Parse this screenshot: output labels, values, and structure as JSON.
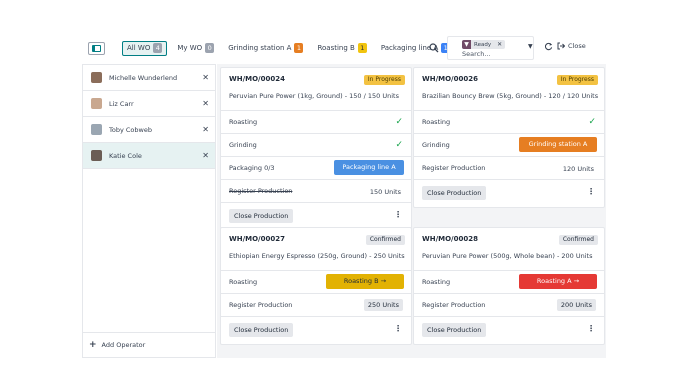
{
  "topbar": {
    "tabs": [
      {
        "label": "All WO",
        "count": "4",
        "badge_color": "grey",
        "active": true
      },
      {
        "label": "My WO",
        "count": "0",
        "badge_color": "grey",
        "active": false
      },
      {
        "label": "Grinding station A",
        "count": "1",
        "badge_color": "orange",
        "active": false
      },
      {
        "label": "Roasting B",
        "count": "1",
        "badge_color": "yellow",
        "active": false
      },
      {
        "label": "Packaging line A",
        "count": "1",
        "badge_color": "blue",
        "active": false
      }
    ],
    "add_tab": "+",
    "search": {
      "facet": "Ready",
      "placeholder": "Search..."
    },
    "close_label": "Close"
  },
  "operators": [
    {
      "name": "Michelle Wunderlend",
      "avatar_color": "#8b6d5a",
      "selected": false
    },
    {
      "name": "Liz Carr",
      "avatar_color": "#c9a890",
      "selected": false
    },
    {
      "name": "Toby Cobweb",
      "avatar_color": "#9aa6b2",
      "selected": false
    },
    {
      "name": "Katie Cole",
      "avatar_color": "#6b5d55",
      "selected": true
    }
  ],
  "add_operator_label": "Add Operator",
  "cards": [
    {
      "id": "WH/MO/00024",
      "status": "In Progress",
      "product": "Peruvian Pure Power (1kg, Ground) - 150 / 150 Units",
      "rows": [
        {
          "label": "Roasting",
          "type": "done"
        },
        {
          "label": "Grinding",
          "type": "done"
        },
        {
          "label": "Packaging",
          "extra": "0/3",
          "type": "button",
          "button": "Packaging line A",
          "color": "blue"
        },
        {
          "label": "Register Production",
          "type": "qty",
          "qty": "150 Units",
          "strike": true
        }
      ],
      "footer": "Close Production"
    },
    {
      "id": "WH/MO/00026",
      "status": "In Progress",
      "product": "Brazilian Bouncy Brew (5kg, Ground) - 120 / 120 Units",
      "rows": [
        {
          "label": "Roasting",
          "type": "done"
        },
        {
          "label": "Grinding",
          "type": "button",
          "button": "Grinding station A",
          "color": "orange"
        },
        {
          "label": "Register Production",
          "type": "qty",
          "qty": "120 Units",
          "strike": false
        }
      ],
      "footer": "Close Production"
    },
    {
      "id": "WH/MO/00027",
      "status": "Confirmed",
      "product": "Ethiopian Energy Espresso (250g, Ground) - 250 Units",
      "rows": [
        {
          "label": "Roasting",
          "type": "button",
          "button": "Roasting B",
          "color": "yellow"
        },
        {
          "label": "Register Production",
          "type": "qtybtn",
          "qty": "250 Units"
        }
      ],
      "footer": "Close Production"
    },
    {
      "id": "WH/MO/00028",
      "status": "Confirmed",
      "product": "Peruvian Pure Power (500g, Whole bean) - 200 Units",
      "rows": [
        {
          "label": "Roasting",
          "type": "button",
          "button": "Roasting A",
          "color": "red"
        },
        {
          "label": "Register Production",
          "type": "qtybtn",
          "qty": "200 Units"
        }
      ],
      "footer": "Close Production"
    }
  ]
}
